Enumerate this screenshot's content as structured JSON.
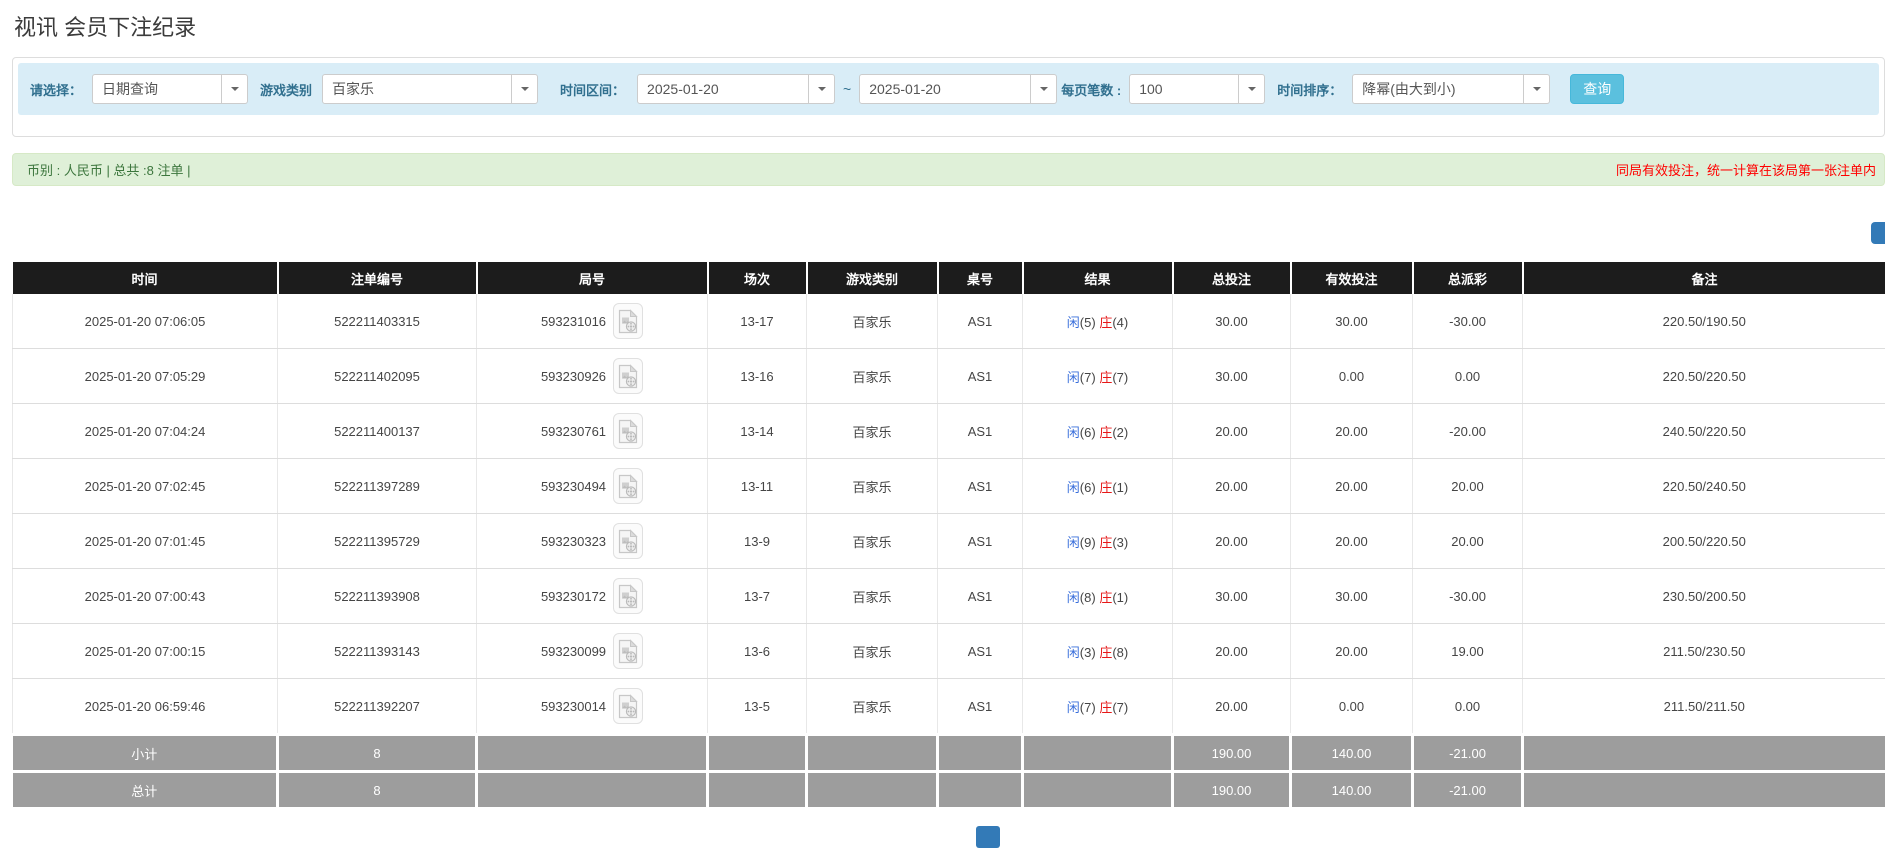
{
  "page": {
    "title": "视讯 会员下注纪录"
  },
  "filters": {
    "select_label": "请选择：",
    "select_value": "日期查询",
    "game_type_label": "游戏类别",
    "game_type_value": "百家乐",
    "date_range_label": "时间区间：",
    "date_from": "2025-01-20",
    "range_separator": "~",
    "date_to": "2025-01-20",
    "page_size_label": "每页笔数 :",
    "page_size_value": "100",
    "sort_label": "时间排序：",
    "sort_value": "降幂(由大到小)",
    "search_button": "查询"
  },
  "summary_bar": {
    "left_text": "币别 : 人民币 | 总共 :8 注单 |",
    "right_text": "同局有效投注，统一计算在该局第一张注单内"
  },
  "table": {
    "headers": [
      "时间",
      "注单编号",
      "局号",
      "场次",
      "游戏类别",
      "桌号",
      "结果",
      "总投注",
      "有效投注",
      "总派彩",
      "备注"
    ],
    "rows": [
      {
        "time": "2025-01-20 07:06:05",
        "bet_id": "522211403315",
        "round_id": "593231016",
        "session": "13-17",
        "game": "百家乐",
        "table_no": "AS1",
        "player": "闲",
        "player_score": "(5)",
        "banker": "庄",
        "banker_score": "(4)",
        "total_bet": "30.00",
        "valid_bet": "30.00",
        "payout": "-30.00",
        "note": "220.50/190.50"
      },
      {
        "time": "2025-01-20 07:05:29",
        "bet_id": "522211402095",
        "round_id": "593230926",
        "session": "13-16",
        "game": "百家乐",
        "table_no": "AS1",
        "player": "闲",
        "player_score": "(7)",
        "banker": "庄",
        "banker_score": "(7)",
        "total_bet": "30.00",
        "valid_bet": "0.00",
        "payout": "0.00",
        "note": "220.50/220.50"
      },
      {
        "time": "2025-01-20 07:04:24",
        "bet_id": "522211400137",
        "round_id": "593230761",
        "session": "13-14",
        "game": "百家乐",
        "table_no": "AS1",
        "player": "闲",
        "player_score": "(6)",
        "banker": "庄",
        "banker_score": "(2)",
        "total_bet": "20.00",
        "valid_bet": "20.00",
        "payout": "-20.00",
        "note": "240.50/220.50"
      },
      {
        "time": "2025-01-20 07:02:45",
        "bet_id": "522211397289",
        "round_id": "593230494",
        "session": "13-11",
        "game": "百家乐",
        "table_no": "AS1",
        "player": "闲",
        "player_score": "(6)",
        "banker": "庄",
        "banker_score": "(1)",
        "total_bet": "20.00",
        "valid_bet": "20.00",
        "payout": "20.00",
        "note": "220.50/240.50"
      },
      {
        "time": "2025-01-20 07:01:45",
        "bet_id": "522211395729",
        "round_id": "593230323",
        "session": "13-9",
        "game": "百家乐",
        "table_no": "AS1",
        "player": "闲",
        "player_score": "(9)",
        "banker": "庄",
        "banker_score": "(3)",
        "total_bet": "20.00",
        "valid_bet": "20.00",
        "payout": "20.00",
        "note": "200.50/220.50"
      },
      {
        "time": "2025-01-20 07:00:43",
        "bet_id": "522211393908",
        "round_id": "593230172",
        "session": "13-7",
        "game": "百家乐",
        "table_no": "AS1",
        "player": "闲",
        "player_score": "(8)",
        "banker": "庄",
        "banker_score": "(1)",
        "total_bet": "30.00",
        "valid_bet": "30.00",
        "payout": "-30.00",
        "note": "230.50/200.50"
      },
      {
        "time": "2025-01-20 07:00:15",
        "bet_id": "522211393143",
        "round_id": "593230099",
        "session": "13-6",
        "game": "百家乐",
        "table_no": "AS1",
        "player": "闲",
        "player_score": "(3)",
        "banker": "庄",
        "banker_score": "(8)",
        "total_bet": "20.00",
        "valid_bet": "20.00",
        "payout": "19.00",
        "note": "211.50/230.50"
      },
      {
        "time": "2025-01-20 06:59:46",
        "bet_id": "522211392207",
        "round_id": "593230014",
        "session": "13-5",
        "game": "百家乐",
        "table_no": "AS1",
        "player": "闲",
        "player_score": "(7)",
        "banker": "庄",
        "banker_score": "(7)",
        "total_bet": "20.00",
        "valid_bet": "0.00",
        "payout": "0.00",
        "note": "211.50/211.50"
      }
    ],
    "subtotal": {
      "label": "小计",
      "count": "8",
      "total_bet": "190.00",
      "valid_bet": "140.00",
      "payout": "-21.00"
    },
    "total": {
      "label": "总计",
      "count": "8",
      "total_bet": "190.00",
      "valid_bet": "140.00",
      "payout": "-21.00"
    }
  },
  "colors": {
    "accent_blue": "#5bc0de",
    "filter_bar_bg": "#d9edf7",
    "filter_label": "#31708f",
    "summary_bg": "#dff0d8",
    "summary_text": "#3c763d",
    "alert_red": "#ff0000",
    "table_header_bg": "#1c1c1c",
    "value_blue": "#3a6fdb",
    "value_red": "#e61919",
    "footer_bg": "#9d9d9d"
  },
  "icons": {
    "video_icon": "video-replay",
    "caret_icon": "chevron-down"
  }
}
